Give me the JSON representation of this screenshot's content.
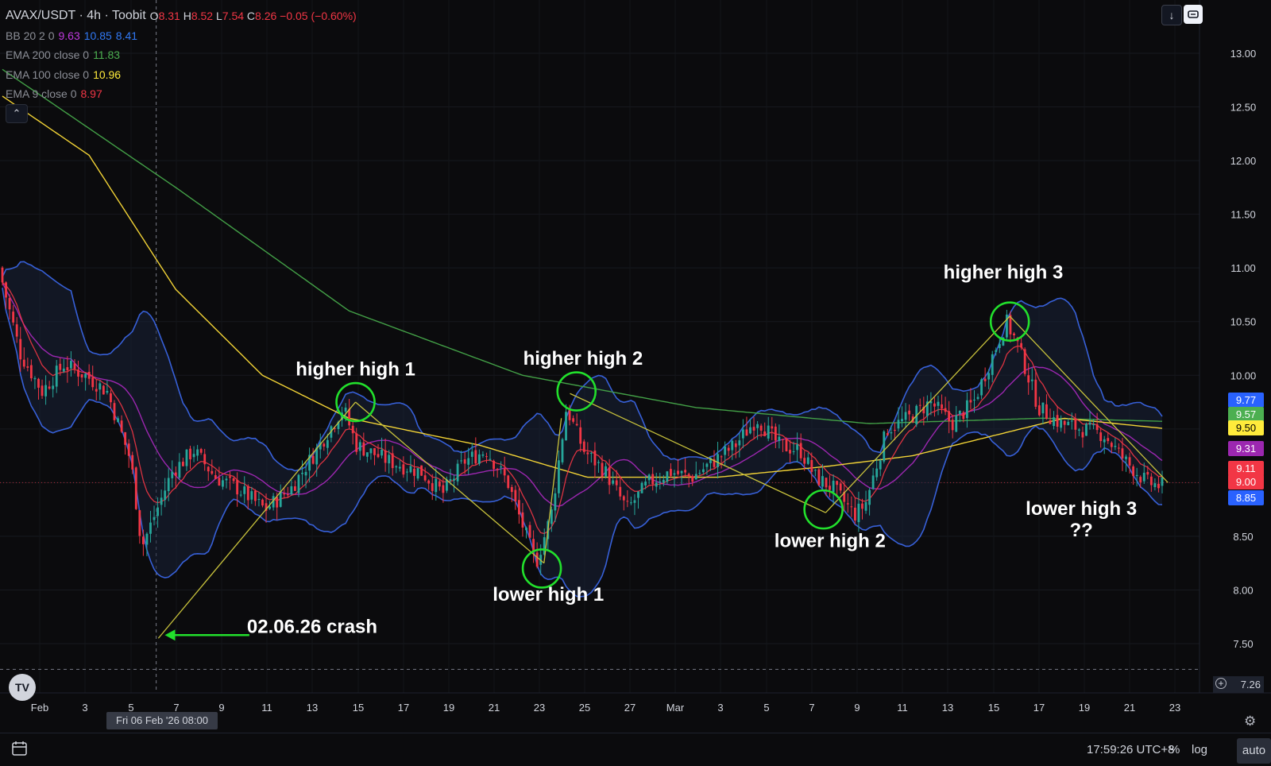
{
  "header": {
    "symbol_title": "AVAX/USDT · 4h · Toobit",
    "ohlc": {
      "o_label": "O",
      "o": "8.31",
      "h_label": "H",
      "h": "8.52",
      "l_label": "L",
      "l": "7.54",
      "c_label": "C",
      "c": "8.26",
      "change": "−0.05 (−0.60%)"
    },
    "indicators": [
      {
        "label": "BB 20 2 0",
        "values": [
          {
            "v": "9.63",
            "color": "#c03adf"
          },
          {
            "v": "10.85",
            "color": "#3179f5"
          },
          {
            "v": "8.41",
            "color": "#3179f5"
          }
        ]
      },
      {
        "label": "EMA 200 close 0",
        "values": [
          {
            "v": "11.83",
            "color": "#4caf50"
          }
        ]
      },
      {
        "label": "EMA 100 close 0",
        "values": [
          {
            "v": "10.96",
            "color": "#ffeb3b"
          }
        ]
      },
      {
        "label": "EMA 9 close 0",
        "values": [
          {
            "v": "8.97",
            "color": "#f23645"
          }
        ]
      }
    ],
    "collapse_icon": "chevron-up-icon",
    "buttons": [
      "download-icon",
      "fullscreen-icon"
    ]
  },
  "price_tags": [
    {
      "value": "9.77",
      "color": "#2962ff"
    },
    {
      "value": "9.57",
      "color": "#4caf50"
    },
    {
      "value": "9.50",
      "color": "#ffeb3b"
    },
    {
      "value": "9.31",
      "color": "#9c27b0"
    },
    {
      "value": "9.11",
      "color": "#f23645"
    },
    {
      "value": "9.00",
      "color": "#f23645"
    },
    {
      "value": "8.85",
      "color": "#2962ff"
    }
  ],
  "last_price_tag": "7.26",
  "crosshair_date": "Fri 06 Feb '26   08:00",
  "footer": {
    "time": "17:59:26 UTC+8",
    "percent": "%",
    "log": "log",
    "auto": "auto"
  },
  "chart_data": {
    "type": "candlestick",
    "symbol": "AVAX/USDT",
    "interval": "4h",
    "y_axis": {
      "ticks": [
        "13.00",
        "12.50",
        "12.00",
        "11.50",
        "11.00",
        "10.50",
        "10.00",
        "9.50",
        "9.00",
        "8.50",
        "8.00",
        "7.50"
      ],
      "range": [
        7.2,
        13.2
      ]
    },
    "x_axis": {
      "tick_labels": [
        "Feb",
        "3",
        "5",
        "7",
        "9",
        "11",
        "13",
        "15",
        "17",
        "19",
        "21",
        "23",
        "25",
        "27",
        "Mar",
        "3",
        "5",
        "7",
        "9",
        "11",
        "13",
        "15",
        "17",
        "19",
        "21",
        "23"
      ],
      "range": [
        0,
        55
      ]
    },
    "key_points": [
      {
        "t": 0.0,
        "p": 11.0
      },
      {
        "t": 1.0,
        "p": 10.2
      },
      {
        "t": 2.0,
        "p": 9.85
      },
      {
        "t": 3.0,
        "p": 10.1
      },
      {
        "t": 4.0,
        "p": 10.0
      },
      {
        "t": 5.0,
        "p": 9.85
      },
      {
        "t": 6.1,
        "p": 9.2
      },
      {
        "t": 6.6,
        "p": 8.4
      },
      {
        "t": 7.2,
        "p": 8.7
      },
      {
        "t": 8.0,
        "p": 9.1
      },
      {
        "t": 9.0,
        "p": 9.3
      },
      {
        "t": 10.0,
        "p": 9.05
      },
      {
        "t": 11.0,
        "p": 8.95
      },
      {
        "t": 12.3,
        "p": 8.75
      },
      {
        "t": 13.5,
        "p": 8.95
      },
      {
        "t": 14.5,
        "p": 9.25
      },
      {
        "t": 15.9,
        "p": 9.7
      },
      {
        "t": 16.5,
        "p": 9.35
      },
      {
        "t": 18.0,
        "p": 9.2
      },
      {
        "t": 19.5,
        "p": 9.1
      },
      {
        "t": 20.5,
        "p": 8.9
      },
      {
        "t": 21.5,
        "p": 9.2
      },
      {
        "t": 22.5,
        "p": 9.3
      },
      {
        "t": 23.5,
        "p": 9.0
      },
      {
        "t": 24.0,
        "p": 8.7
      },
      {
        "t": 24.8,
        "p": 8.25
      },
      {
        "t": 25.5,
        "p": 8.7
      },
      {
        "t": 26.2,
        "p": 9.7
      },
      {
        "t": 27.0,
        "p": 9.3
      },
      {
        "t": 28.0,
        "p": 9.1
      },
      {
        "t": 29.0,
        "p": 8.75
      },
      {
        "t": 30.0,
        "p": 9.0
      },
      {
        "t": 31.0,
        "p": 9.1
      },
      {
        "t": 32.0,
        "p": 9.05
      },
      {
        "t": 33.0,
        "p": 9.2
      },
      {
        "t": 34.0,
        "p": 9.35
      },
      {
        "t": 35.0,
        "p": 9.6
      },
      {
        "t": 36.0,
        "p": 9.35
      },
      {
        "t": 37.0,
        "p": 9.3
      },
      {
        "t": 37.7,
        "p": 9.05
      },
      {
        "t": 38.5,
        "p": 8.95
      },
      {
        "t": 39.5,
        "p": 8.7
      },
      {
        "t": 40.0,
        "p": 8.8
      },
      {
        "t": 41.0,
        "p": 9.5
      },
      {
        "t": 42.0,
        "p": 9.6
      },
      {
        "t": 43.0,
        "p": 9.75
      },
      {
        "t": 44.0,
        "p": 9.55
      },
      {
        "t": 45.0,
        "p": 9.75
      },
      {
        "t": 46.0,
        "p": 10.25
      },
      {
        "t": 46.5,
        "p": 10.5
      },
      {
        "t": 47.0,
        "p": 10.3
      },
      {
        "t": 48.0,
        "p": 9.7
      },
      {
        "t": 49.0,
        "p": 9.55
      },
      {
        "t": 50.0,
        "p": 9.5
      },
      {
        "t": 51.0,
        "p": 9.45
      },
      {
        "t": 52.0,
        "p": 9.2
      },
      {
        "t": 53.0,
        "p": 9.0
      },
      {
        "t": 53.6,
        "p": 8.97
      }
    ],
    "ema200": [
      {
        "t": 0,
        "p": 12.85
      },
      {
        "t": 8,
        "p": 11.75
      },
      {
        "t": 16,
        "p": 10.6
      },
      {
        "t": 24,
        "p": 10.0
      },
      {
        "t": 32,
        "p": 9.7
      },
      {
        "t": 40,
        "p": 9.55
      },
      {
        "t": 48,
        "p": 9.6
      },
      {
        "t": 53.8,
        "p": 9.57
      }
    ],
    "ema100": [
      {
        "t": 0,
        "p": 12.6
      },
      {
        "t": 4,
        "p": 12.05
      },
      {
        "t": 8,
        "p": 10.8
      },
      {
        "t": 12,
        "p": 10.0
      },
      {
        "t": 16,
        "p": 9.6
      },
      {
        "t": 22,
        "p": 9.35
      },
      {
        "t": 27,
        "p": 9.05
      },
      {
        "t": 33,
        "p": 9.05
      },
      {
        "t": 38,
        "p": 9.15
      },
      {
        "t": 42,
        "p": 9.25
      },
      {
        "t": 46,
        "p": 9.45
      },
      {
        "t": 49,
        "p": 9.6
      },
      {
        "t": 53.8,
        "p": 9.5
      }
    ],
    "trend_lines": [
      [
        {
          "t": 7.2,
          "p": 7.55
        },
        {
          "t": 16.3,
          "p": 9.75
        }
      ],
      [
        {
          "t": 16.3,
          "p": 9.75
        },
        {
          "t": 25.0,
          "p": 8.25
        }
      ],
      [
        {
          "t": 25.0,
          "p": 8.25
        },
        {
          "t": 25.8,
          "p": 9.6
        }
      ],
      [
        {
          "t": 26.2,
          "p": 9.83
        },
        {
          "t": 38.0,
          "p": 8.72
        }
      ],
      [
        {
          "t": 38.0,
          "p": 8.72
        },
        {
          "t": 46.5,
          "p": 10.55
        }
      ],
      [
        {
          "t": 46.5,
          "p": 10.55
        },
        {
          "t": 53.8,
          "p": 9.0
        }
      ]
    ],
    "circles": [
      {
        "t": 16.3,
        "p": 9.75
      },
      {
        "t": 26.5,
        "p": 9.85
      },
      {
        "t": 46.5,
        "p": 10.5
      },
      {
        "t": 24.9,
        "p": 8.2
      },
      {
        "t": 37.9,
        "p": 8.75
      }
    ],
    "annotations": [
      {
        "text": "higher high 1",
        "t": 16.3,
        "p": 10.0
      },
      {
        "text": "higher high 2",
        "t": 26.8,
        "p": 10.1
      },
      {
        "text": "higher high 3",
        "t": 46.2,
        "p": 10.9
      },
      {
        "text": "lower high 1",
        "t": 25.2,
        "p": 7.9
      },
      {
        "text": "lower high 2",
        "t": 38.2,
        "p": 8.4
      },
      {
        "text": "lower high 3",
        "t": 49.8,
        "p": 8.7
      },
      {
        "text": "??",
        "t": 49.8,
        "p": 8.5
      },
      {
        "text": "02.06.26 crash",
        "t": 14.3,
        "p": 7.6
      }
    ],
    "arrow": {
      "from": {
        "t": 11.4,
        "p": 7.58
      },
      "to": {
        "t": 7.5,
        "p": 7.58
      }
    },
    "crosshair": {
      "t": 7.1,
      "p": 7.26
    },
    "colors": {
      "up": "#26a69a",
      "down": "#f23645",
      "bb": "#3760d8",
      "bb_basis": "#9c27b0",
      "ema9": "#f23645",
      "ema100": "#f2d336",
      "ema200": "#43a047",
      "trend": "#c8c23c",
      "circle": "#22e02c",
      "arrow": "#22e02c"
    }
  }
}
